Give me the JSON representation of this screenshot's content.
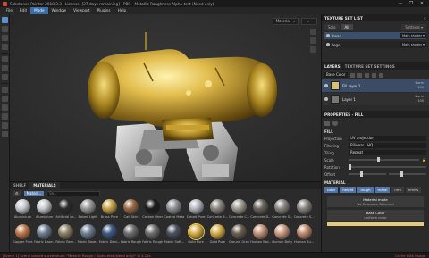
{
  "window": {
    "title": "Substance Painter 2018.3.3 - License: [27 days remaining] - PBR - Metallic Roughness Alpha-test (Need only)",
    "controls": [
      "—",
      "❐",
      "✕"
    ]
  },
  "menu": [
    "File",
    "Edit",
    "Mode",
    "Window",
    "Viewport",
    "Plugins",
    "Help"
  ],
  "menu_active": "Mode",
  "viewport": {
    "material_dropdown": "Material",
    "camera_dropdown": ""
  },
  "shelf": {
    "tabs": [
      "SHELF",
      "MATERIALS"
    ],
    "active_tab": "MATERIALS",
    "filter_chips": [
      "Materi..."
    ],
    "search_placeholder": "Se...",
    "materials_row1": [
      "Aluminium",
      "Aluminium",
      "Artificial Le...",
      "Baked Light",
      "Brass Pure",
      "Calf Skin",
      "Carbon Fiber",
      "Coated Metal",
      "Cobalt Pure",
      "Concrete B...",
      "Concrete C...",
      "Concrete D...",
      "Concrete S...",
      "Concrete S..."
    ],
    "materials_row2": [
      "Copper Pure",
      "Fabric Base...",
      "Fabric Bam...",
      "Fabric Base...",
      "Fabric Deni...",
      "Fabric Rough",
      "Fabric Rough",
      "Fabric Soft...",
      "Gold Pure",
      "Gold Pure",
      "Ground Grav...",
      "Human Bac...",
      "Human Belly...",
      "Human Bu..."
    ],
    "selected": "Gold Pure"
  },
  "texture_set_list": {
    "title": "TEXTURE SET LIST",
    "tabs": [
      "Solo",
      "All"
    ],
    "settings_label": "Settings ▾",
    "rows": [
      {
        "name": "head",
        "shader": "Main shader ▾",
        "selected": true
      },
      {
        "name": "legs",
        "shader": "Main shader ▾",
        "selected": false
      }
    ]
  },
  "layers": {
    "tab_layers": "LAYERS",
    "tab_settings": "TEXTURE SET SETTINGS",
    "channel_dropdown": "Base Color",
    "rows": [
      {
        "name": "Fill layer 1",
        "blend": "Norm",
        "opacity": "100",
        "selected": true
      },
      {
        "name": "Layer 1",
        "blend": "Norm",
        "opacity": "100",
        "selected": false
      }
    ]
  },
  "properties": {
    "title": "PROPERTIES - FILL",
    "fill_section": "FILL",
    "projection_label": "Projection",
    "projection_value": "UV projection",
    "filtering_label": "Filtering",
    "filtering_value": "Bilinear | HQ",
    "tiling_label": "Tiling",
    "tiling_value": "Repeat",
    "scale_label": "Scale",
    "rotation_label": "Rotation",
    "offset_label": "Offset",
    "material_section": "MATERIAL",
    "channels": [
      "color",
      "height",
      "rough",
      "metal",
      "nrm",
      "emiss"
    ],
    "material_mode_title": "Material mode",
    "material_mode_sub": "No Resource Selected",
    "base_color_title": "Base Color",
    "base_color_sub": "uniform color"
  },
  "status": {
    "message": "[Scene 1] Scene loaded successfully: \"Metallic Rough / Alpha-test (Need only)\" in 4.12s",
    "ram": "Cache Disk Usage"
  },
  "colors": {
    "accent": "#3b6ea5",
    "gold": "#d4af37",
    "panel_bg": "#2a2a2a"
  }
}
